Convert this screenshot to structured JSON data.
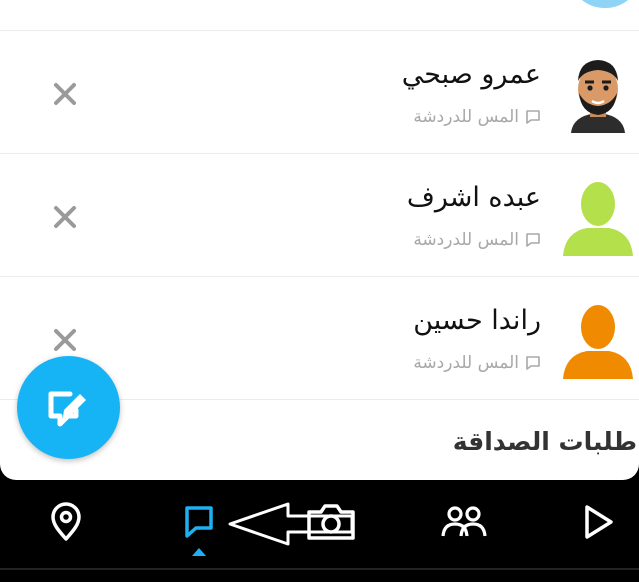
{
  "friends": [
    {
      "name": "عمرو صبحي",
      "subtitle": "المس للدردشة",
      "avatar": "bitmoji-avatar"
    },
    {
      "name": "عبده اشرف",
      "subtitle": "المس للدردشة",
      "avatar": "default-avatar-green",
      "color": "#b4e04b"
    },
    {
      "name": "راندا حسين",
      "subtitle": "المس للدردشة",
      "avatar": "default-avatar-orange",
      "color": "#f08a00"
    }
  ],
  "section": {
    "title": "طلبات الصداقة"
  },
  "colors": {
    "accent": "#17b4f5",
    "active_nav": "#1fb0f2"
  },
  "nav": {
    "items": [
      "map-pin-icon",
      "chat-icon",
      "camera-icon",
      "friends-icon",
      "play-icon"
    ],
    "active": "chat-icon"
  }
}
